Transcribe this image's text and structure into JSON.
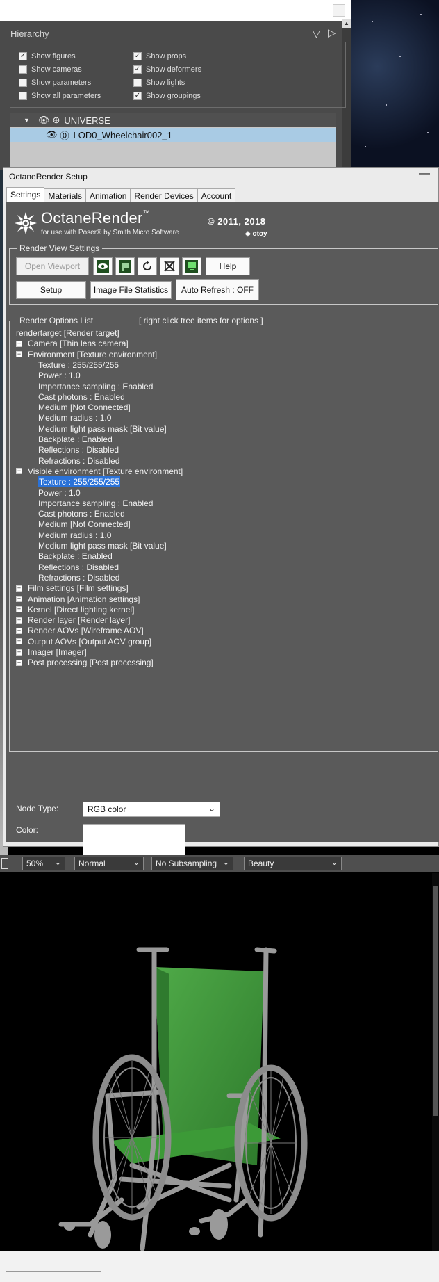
{
  "hierarchy": {
    "title": "Hierarchy",
    "options": [
      {
        "label": "Show figures",
        "checked": true
      },
      {
        "label": "Show props",
        "checked": true
      },
      {
        "label": "Show cameras",
        "checked": false
      },
      {
        "label": "Show deformers",
        "checked": true
      },
      {
        "label": "Show parameters",
        "checked": false
      },
      {
        "label": "Show lights",
        "checked": false
      },
      {
        "label": "Show all parameters",
        "checked": false
      },
      {
        "label": "Show groupings",
        "checked": true
      }
    ],
    "tree": {
      "root": "UNIVERSE",
      "child": "LOD0_Wheelchair002_1"
    }
  },
  "window": {
    "title": "OctaneRender Setup",
    "minimize": "—",
    "tabs": [
      "Settings",
      "Materials",
      "Animation",
      "Render Devices",
      "Account"
    ],
    "active_tab": "Settings"
  },
  "logo": {
    "name": "OctaneRender",
    "tm": "™",
    "subtitle": "for use with Poser® by Smith Micro Software",
    "copyright": "© 2011, 2018",
    "otoy": "◈ otoy"
  },
  "render_view": {
    "group_label": "Render View Settings",
    "buttons": {
      "open_viewport": "Open Viewport",
      "help": "Help",
      "setup": "Setup",
      "image_file_statistics": "Image File Statistics",
      "auto_refresh": "Auto Refresh : OFF"
    }
  },
  "render_options": {
    "group_label": "Render Options List",
    "hint": "[ right click tree items for options ]",
    "root": "rendertarget   [Render target]",
    "items": [
      {
        "text": "Camera   [Thin lens camera]",
        "level": 1,
        "expander": "+"
      },
      {
        "text": "Environment   [Texture environment]",
        "level": 1,
        "expander": "−"
      },
      {
        "text": "Texture  :  255/255/255",
        "level": 2
      },
      {
        "text": "Power  :  1.0",
        "level": 2
      },
      {
        "text": "Importance sampling  :  Enabled",
        "level": 2
      },
      {
        "text": "Cast photons  :  Enabled",
        "level": 2
      },
      {
        "text": "Medium   [Not Connected]",
        "level": 2
      },
      {
        "text": "Medium radius  :  1.0",
        "level": 2
      },
      {
        "text": "Medium light pass mask   [Bit value]",
        "level": 2
      },
      {
        "text": "Backplate  :  Enabled",
        "level": 2
      },
      {
        "text": "Reflections  :  Disabled",
        "level": 2
      },
      {
        "text": "Refractions  :  Disabled",
        "level": 2
      },
      {
        "text": "Visible environment   [Texture environment]",
        "level": 1,
        "expander": "−"
      },
      {
        "text": "Texture  :  255/255/255",
        "level": 2,
        "selected": true
      },
      {
        "text": "Power  :  1.0",
        "level": 2
      },
      {
        "text": "Importance sampling  :  Enabled",
        "level": 2
      },
      {
        "text": "Cast photons  :  Enabled",
        "level": 2
      },
      {
        "text": "Medium   [Not Connected]",
        "level": 2
      },
      {
        "text": "Medium radius  :  1.0",
        "level": 2
      },
      {
        "text": "Medium light pass mask   [Bit value]",
        "level": 2
      },
      {
        "text": "Backplate  :  Enabled",
        "level": 2
      },
      {
        "text": "Reflections  :  Disabled",
        "level": 2
      },
      {
        "text": "Refractions  :  Disabled",
        "level": 2
      },
      {
        "text": "Film settings   [Film settings]",
        "level": 1,
        "expander": "+"
      },
      {
        "text": "Animation   [Animation settings]",
        "level": 1,
        "expander": "+"
      },
      {
        "text": "Kernel   [Direct lighting kernel]",
        "level": 1,
        "expander": "+"
      },
      {
        "text": "Render layer   [Render layer]",
        "level": 1,
        "expander": "+"
      },
      {
        "text": "Render AOVs   [Wireframe AOV]",
        "level": 1,
        "expander": "+"
      },
      {
        "text": "Output AOVs   [Output AOV group]",
        "level": 1,
        "expander": "+"
      },
      {
        "text": "Imager   [Imager]",
        "level": 1,
        "expander": "+"
      },
      {
        "text": "Post processing   [Post processing]",
        "level": 1,
        "expander": "+"
      }
    ]
  },
  "node": {
    "type_label": "Node Type:",
    "type_value": "RGB color",
    "color_label": "Color:",
    "color_value": "#ffffff"
  },
  "render_toolbar": {
    "zoom": "50%",
    "mode": "Normal",
    "subsampling": "No Subsampling",
    "pass": "Beauty"
  },
  "colors": {
    "panel_bg": "#5a5a5a",
    "selection": "#2a72d8",
    "seat_green": "#3f9a3c"
  }
}
